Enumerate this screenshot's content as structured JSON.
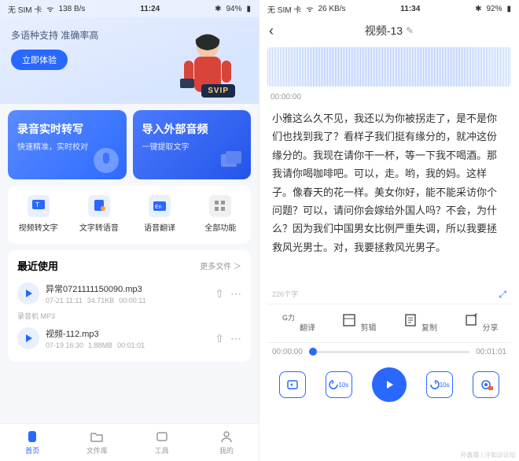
{
  "left": {
    "status": {
      "sim": "无 SIM 卡",
      "net": "138 B/s",
      "time": "11:24",
      "bt": "✱",
      "batt": "94%"
    },
    "banner": {
      "title": "多语种支持 准确率高",
      "cta": "立即体验",
      "svip": "SVIP"
    },
    "cards": [
      {
        "title": "录音实时转写",
        "sub": "快速精准，实时校对"
      },
      {
        "title": "导入外部音频",
        "sub": "一键提取文字"
      }
    ],
    "grid": [
      {
        "label": "视频转文字"
      },
      {
        "label": "文字转语音"
      },
      {
        "label": "语音翻译"
      },
      {
        "label": "全部功能"
      }
    ],
    "recent": {
      "title": "最近使用",
      "more": "更多文件 ＞",
      "recorder_label": "录音机   MP3",
      "files": [
        {
          "name": "异常0721111150090.mp3",
          "date": "07-21 11:11",
          "size": "34.71KB",
          "dur": "00:00:11"
        },
        {
          "name": "视频-112.mp3",
          "date": "07-19 16:30",
          "size": "1.88MB",
          "dur": "00:01:01"
        }
      ]
    },
    "tabs": [
      "首页",
      "文件库",
      "工具",
      "我的"
    ]
  },
  "right": {
    "status": {
      "sim": "无 SIM 卡",
      "net": "26 KB/s",
      "time": "11:34",
      "bt": "✱",
      "batt": "92%"
    },
    "title": "视频-13",
    "time0": "00:00:00",
    "transcript": "小雅这么久不见，我还以为你被拐走了，是不是你们也找到我了？看样子我们挺有缘分的，就冲这份缘分的。我现在请你干一杯，等一下我不喝酒。那我请你喝咖啡吧。可以，走。哟，我的妈。这样子。像春天的花一样。美女你好，能不能采访你个问题？可以，请问你会嫁给外国人吗？不会，为什么？因为我们中国男女比例严重失调，所以我要拯救风光男士。对，我要拯救风光男子。",
    "char_count": "226个字",
    "actions": [
      "翻译",
      "剪辑",
      "复制",
      "分享"
    ],
    "player": {
      "cur": "00:00:00",
      "total": "00:01:01",
      "back": "10s",
      "fwd": "10s"
    }
  },
  "watermark": "孙鑫晨 | 冷知识论坛"
}
